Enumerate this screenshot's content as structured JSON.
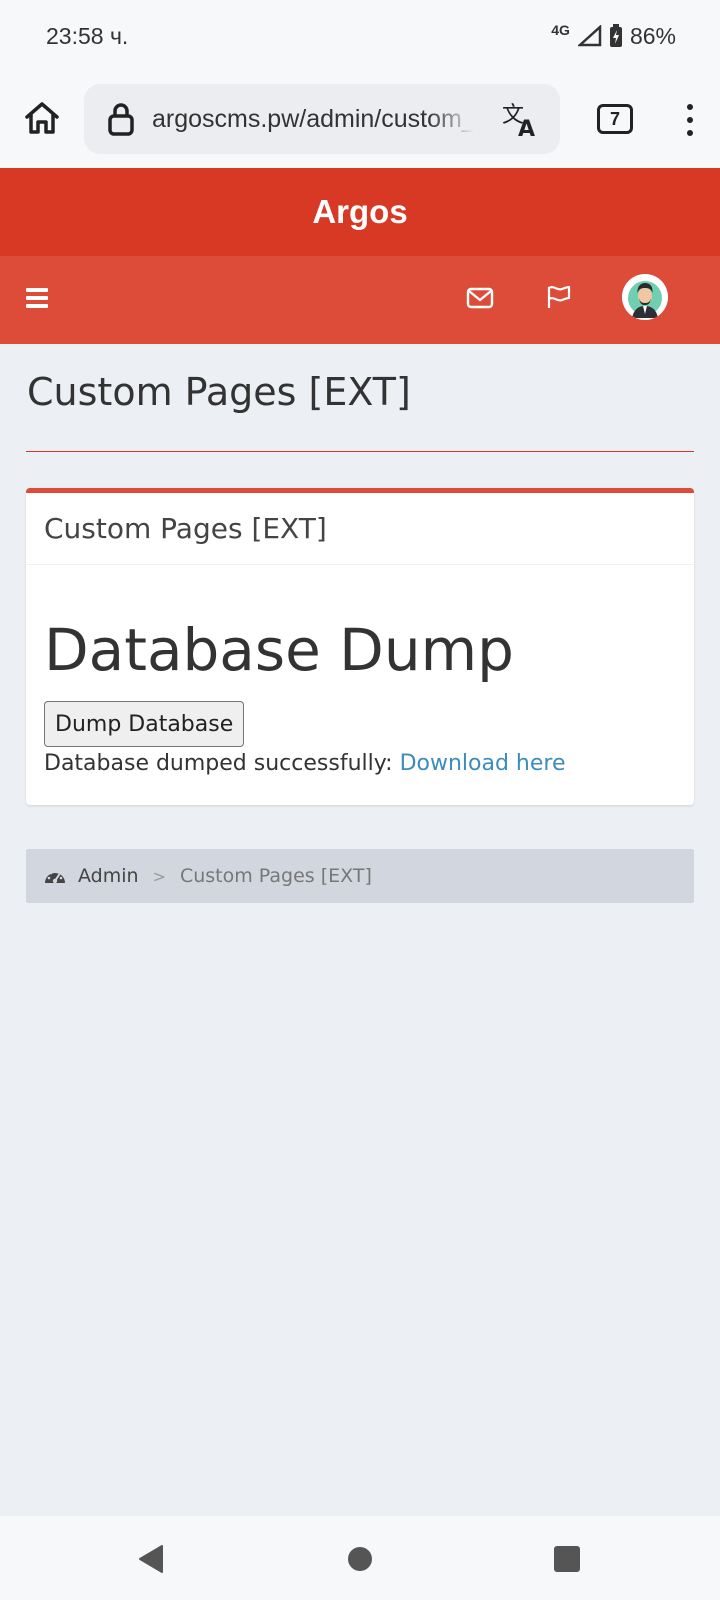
{
  "status_bar": {
    "time": "23:58 ч.",
    "network": "4G",
    "battery": "86%"
  },
  "browser": {
    "url": "argoscms.pw/admin/custom_pages",
    "tab_count": "7"
  },
  "app": {
    "title": "Argos",
    "accent_color": "#dd4b39",
    "header_color": "#d73925"
  },
  "page": {
    "title": "Custom Pages [EXT]"
  },
  "box": {
    "title": "Custom Pages [EXT]",
    "heading": "Database Dump",
    "button_label": "Dump Database",
    "success_text": "Database dumped successfully: ",
    "download_link": "Download here",
    "link_color": "#3c8dbc"
  },
  "breadcrumb": {
    "root": "Admin",
    "separator": ">",
    "current": "Custom Pages [EXT]"
  }
}
